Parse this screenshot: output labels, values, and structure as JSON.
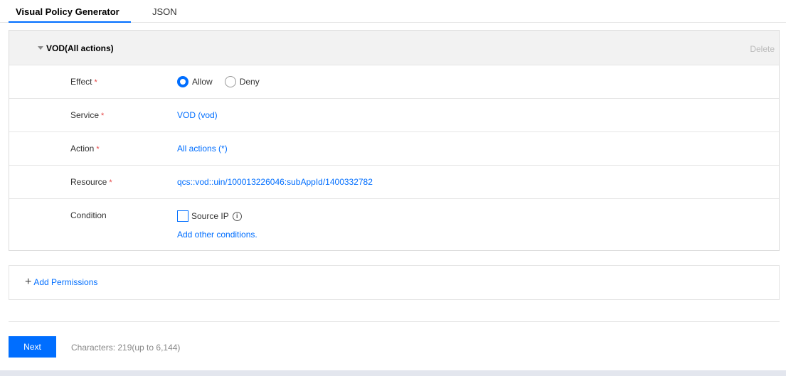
{
  "tabs": {
    "visual": "Visual Policy Generator",
    "json": "JSON"
  },
  "policy": {
    "title": "VOD(All actions)",
    "delete_label": "Delete",
    "effect": {
      "label": "Effect",
      "options": [
        "Allow",
        "Deny"
      ],
      "selected": "Allow"
    },
    "service": {
      "label": "Service",
      "value": "VOD (vod)"
    },
    "action": {
      "label": "Action",
      "value": "All actions (*)"
    },
    "resource": {
      "label": "Resource",
      "value": "qcs::vod::uin/100013226046:subAppId/1400332782"
    },
    "condition": {
      "label": "Condition",
      "checkbox_label": "Source IP",
      "checked": false,
      "add_label": "Add other conditions."
    },
    "required_mark": "*"
  },
  "add_permissions": "Add Permissions",
  "footer": {
    "next_label": "Next",
    "char_count": "Characters: 219(up to 6,144)"
  },
  "colors": {
    "accent": "#006eff",
    "required": "#e54545",
    "header_bg": "#f2f2f2"
  }
}
